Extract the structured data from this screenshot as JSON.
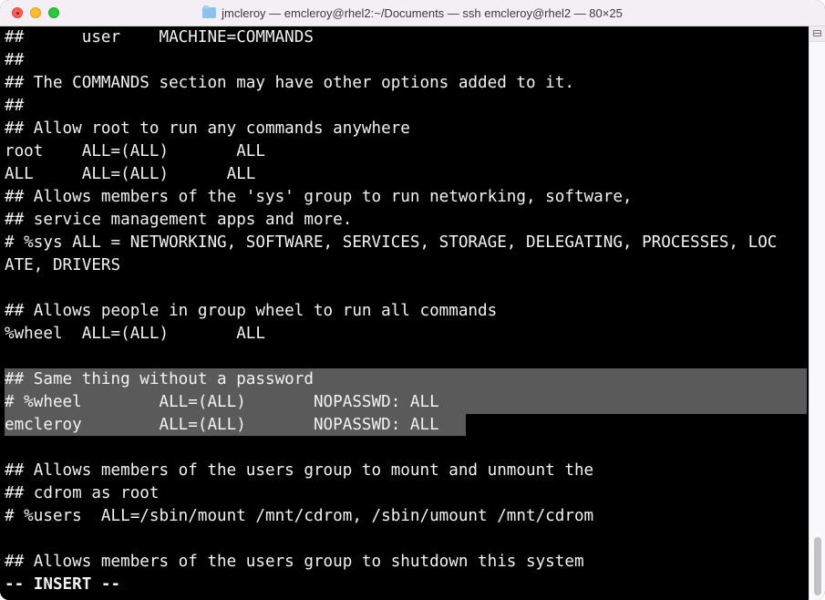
{
  "window": {
    "title": "jmcleroy — emcleroy@rhel2:~/Documents — ssh emcleroy@rhel2 — 80×25",
    "title_icon": "folder-icon",
    "controls": [
      "close",
      "minimize",
      "maximize"
    ]
  },
  "terminal": {
    "mode_indicator": "-- INSERT --",
    "lines": [
      "##      user    MACHINE=COMMANDS",
      "##",
      "## The COMMANDS section may have other options added to it.",
      "##",
      "## Allow root to run any commands anywhere",
      "root    ALL=(ALL)       ALL",
      "ALL     ALL=(ALL)      ALL",
      "## Allows members of the 'sys' group to run networking, software,",
      "## service management apps and more.",
      "# %sys ALL = NETWORKING, SOFTWARE, SERVICES, STORAGE, DELEGATING, PROCESSES, LOC",
      "ATE, DRIVERS",
      "",
      "## Allows people in group wheel to run all commands",
      "%wheel  ALL=(ALL)       ALL",
      "",
      "## Same thing without a password",
      "# %wheel        ALL=(ALL)       NOPASSWD: ALL",
      "emcleroy        ALL=(ALL)       NOPASSWD: ALL",
      "",
      "## Allows members of the users group to mount and unmount the",
      "## cdrom as root",
      "# %users  ALL=/sbin/mount /mnt/cdrom, /sbin/umount /mnt/cdrom",
      "",
      "## Allows members of the users group to shutdown this system"
    ],
    "selected_lines": [
      15,
      16,
      17
    ]
  },
  "scrollbar": {
    "position": "bottom"
  }
}
